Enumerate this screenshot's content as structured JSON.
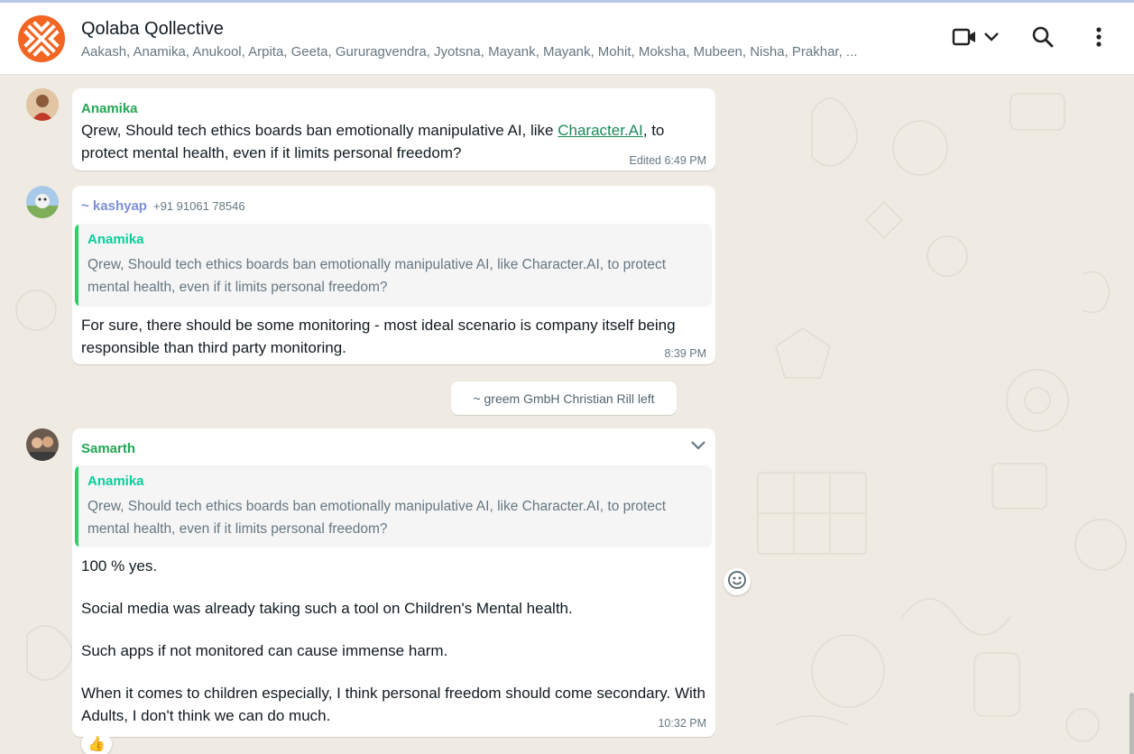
{
  "header": {
    "title": "Qolaba Qollective",
    "members": "Aakash, Anamika, Anukool, Arpita, Geeta, Gururagvendra, Jyotsna, Mayank, Mayank, Mohit, Moksha, Mubeen, Nisha, Prakhar, ..."
  },
  "messages": [
    {
      "sender": "Anamika",
      "text_before_link": "Qrew, Should tech ethics boards ban emotionally manipulative AI, like ",
      "link": "Character.AI",
      "text_after_link": ", to protect mental health, even if it limits personal freedom?",
      "time": "Edited 6:49 PM"
    },
    {
      "sender": "~ kashyap",
      "phone": "+91 91061 78546",
      "quote_sender": "Anamika",
      "quote_text": "Qrew, Should tech ethics boards ban emotionally manipulative AI, like Character.AI, to protect mental health, even if it limits personal freedom?",
      "text": "For sure, there should be some monitoring - most ideal scenario is company itself being responsible than third party monitoring.",
      "time": "8:39 PM"
    },
    {
      "sender": "Samarth",
      "quote_sender": "Anamika",
      "quote_text": "Qrew, Should tech ethics boards ban emotionally manipulative AI, like Character.AI, to protect mental health, even if it limits personal freedom?",
      "paragraphs": [
        "100 % yes.",
        "Social media was already taking such a tool on Children's Mental health.",
        "Such apps if not monitored can cause immense harm.",
        "When it comes to children especially, I think personal freedom should come secondary. With Adults, I don't think we can do much."
      ],
      "time": "10:32 PM",
      "reaction": "👍"
    }
  ],
  "system_message": "~ greem GmbH Christian Rill left",
  "icons": {
    "video": "video-call-icon",
    "chevron": "chevron-down-icon",
    "search": "search-icon",
    "menu": "more-vert-icon",
    "emoji": "emoji-react-icon"
  },
  "colors": {
    "accent_orange": "#f26522",
    "sender_green": "#1fa855",
    "sender_kashyap": "#7e90d6",
    "quote_bar": "#25d366",
    "chat_bg": "#efeae2"
  }
}
